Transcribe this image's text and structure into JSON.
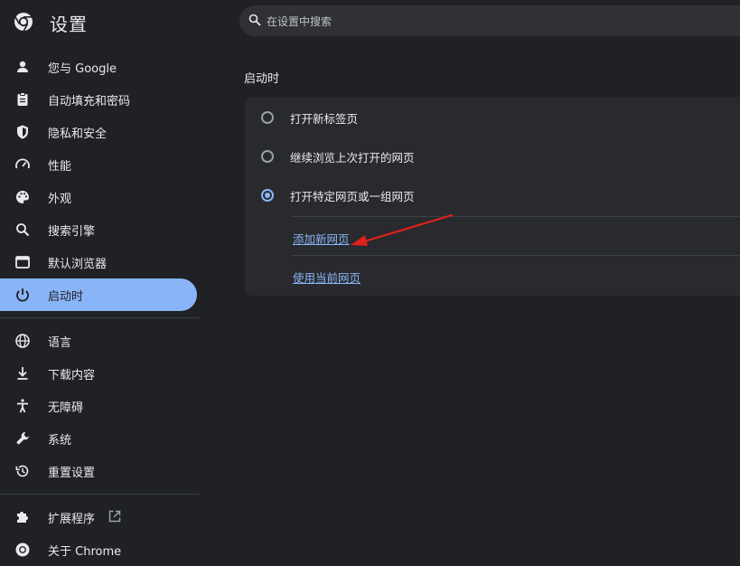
{
  "header": {
    "title": "设置",
    "logo_icon": "chrome-logo-icon",
    "search": {
      "placeholder": "在设置中搜索",
      "icon": "search-icon"
    }
  },
  "sidebar": {
    "items": [
      {
        "label": "您与 Google",
        "icon": "person-icon"
      },
      {
        "label": "自动填充和密码",
        "icon": "clipboard-icon"
      },
      {
        "label": "隐私和安全",
        "icon": "shield-icon"
      },
      {
        "label": "性能",
        "icon": "speedometer-icon"
      },
      {
        "label": "外观",
        "icon": "palette-icon"
      },
      {
        "label": "搜索引擎",
        "icon": "search-icon"
      },
      {
        "label": "默认浏览器",
        "icon": "browser-icon"
      },
      {
        "label": "启动时",
        "icon": "power-icon",
        "active": true
      }
    ],
    "items2": [
      {
        "label": "语言",
        "icon": "globe-icon"
      },
      {
        "label": "下载内容",
        "icon": "download-icon"
      },
      {
        "label": "无障碍",
        "icon": "accessibility-icon"
      },
      {
        "label": "系统",
        "icon": "wrench-icon"
      },
      {
        "label": "重置设置",
        "icon": "history-icon"
      }
    ],
    "items3": [
      {
        "label": "扩展程序",
        "icon": "puzzle-icon",
        "external_icon": "open-in-new-icon"
      },
      {
        "label": "关于 Chrome",
        "icon": "chrome-logo-icon"
      }
    ]
  },
  "main": {
    "section_title": "启动时",
    "options": [
      {
        "label": "打开新标签页",
        "checked": false
      },
      {
        "label": "继续浏览上次打开的网页",
        "checked": false
      },
      {
        "label": "打开特定网页或一组网页",
        "checked": true
      }
    ],
    "links": {
      "add_page": "添加新网页",
      "use_current": "使用当前网页"
    }
  },
  "colors": {
    "background": "#202124",
    "card": "#292a2d",
    "accent": "#8ab4f8",
    "annotation_arrow": "#e0201e"
  }
}
